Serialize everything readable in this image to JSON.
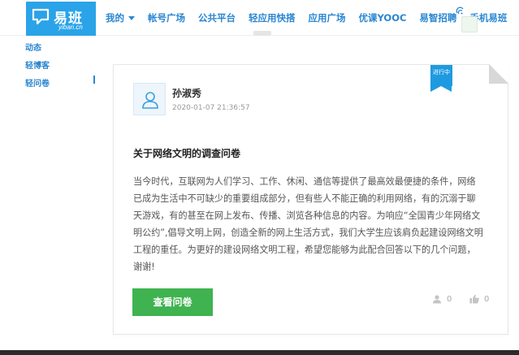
{
  "brand": {
    "name": "易班",
    "sub": "yiban.cn",
    "color": "#2aa3e8"
  },
  "nav": {
    "items": [
      {
        "label": "我的",
        "dropdown": true
      },
      {
        "label": "帐号广场"
      },
      {
        "label": "公共平台"
      },
      {
        "label": "轻应用快搭"
      },
      {
        "label": "应用广场"
      },
      {
        "label": "优课YOOC"
      },
      {
        "label": "易智招聘"
      },
      {
        "label": "手机易班"
      }
    ]
  },
  "sidebar": {
    "items": [
      {
        "label": "动态"
      },
      {
        "label": "轻博客"
      },
      {
        "label": "轻问卷",
        "active": true
      }
    ]
  },
  "post": {
    "status": "进行中",
    "author": "孙淑秀",
    "date": "2020-01-07 21:36:57",
    "title": "关于网络文明的调查问卷",
    "body": "当今时代，互联网为人们学习、工作、休闲、通信等提供了最高效最便捷的条件，网络已成为生活中不可缺少的重要组成部分，但有些人不能正确的利用网络，有的沉溺于聊天游戏，有的甚至在网上发布、传播、浏览各种信息的内容。为响应“全国青少年网络文明公约”,倡导文明上网，创造全新的网上生活方式，我们大学生应该肩负起建设网络文明工程的重任。为更好的建设网络文明工程，希望您能够为此配合回答以下的几个问题，谢谢!",
    "view_button": "查看问卷",
    "participants": "0",
    "likes": "0"
  },
  "colors": {
    "accent": "#2a86d1",
    "button": "#3eb34f",
    "status": "#1f9ae0"
  }
}
